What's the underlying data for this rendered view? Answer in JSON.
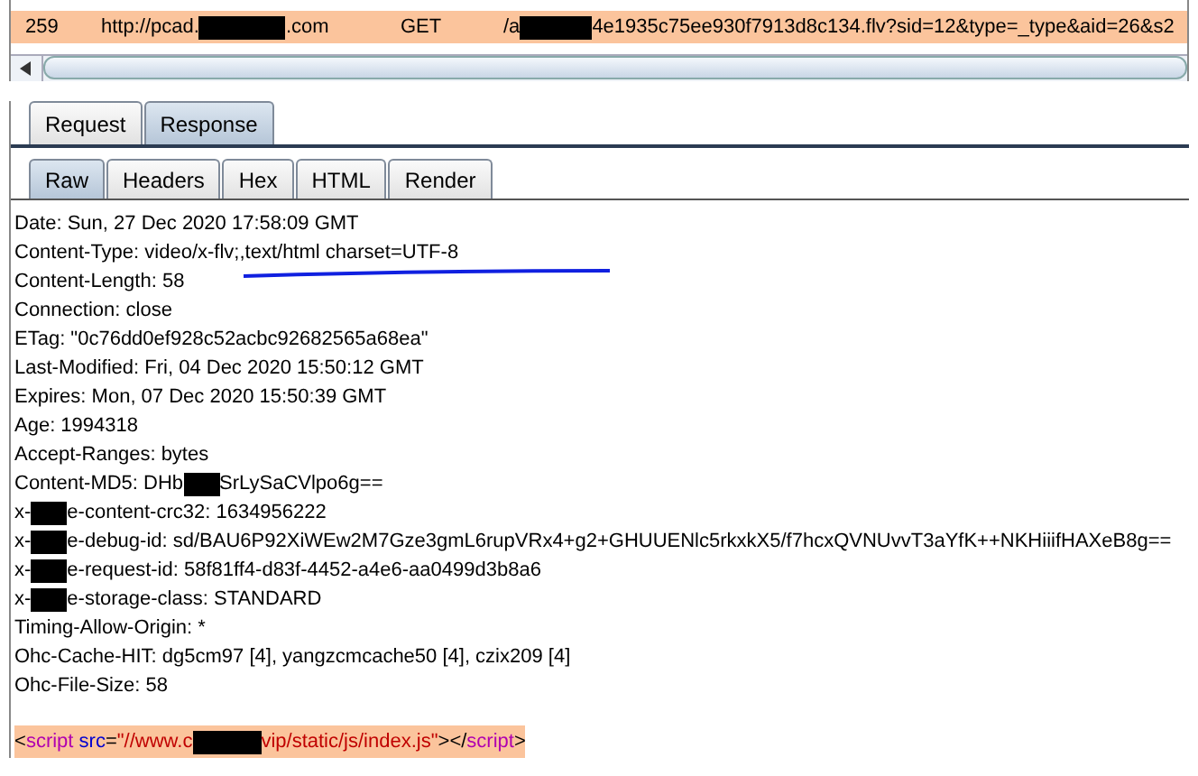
{
  "history_row": {
    "number": "259",
    "host": [
      {
        "kind": "text",
        "text": "http://pcad."
      },
      {
        "kind": "redaction"
      },
      {
        "kind": "text",
        "text": ".com"
      }
    ],
    "method": "GET",
    "url": [
      {
        "kind": "text",
        "text": "/a"
      },
      {
        "kind": "redaction"
      },
      {
        "kind": "text",
        "text": "4e1935c75ee930f7913d8c134.flv?sid=12&type=_type&aid=26&s2"
      }
    ],
    "selected": true
  },
  "tabs": [
    {
      "label": "Request",
      "selected": false
    },
    {
      "label": "Response",
      "selected": true
    }
  ],
  "subtabs": [
    {
      "label": "Raw",
      "selected": true
    },
    {
      "label": "Headers",
      "selected": false
    },
    {
      "label": "Hex",
      "selected": false
    },
    {
      "label": "HTML",
      "selected": false
    },
    {
      "label": "Render",
      "selected": false
    }
  ],
  "headers": [
    [
      {
        "kind": "text",
        "text": "Date: Sun, 27 Dec 2020 17:58:09 GMT"
      }
    ],
    [
      {
        "kind": "text",
        "text": "Content-Type: video/x-flv;,text/html charset=UTF-8"
      }
    ],
    [
      {
        "kind": "text",
        "text": "Content-Length: 58"
      }
    ],
    [
      {
        "kind": "text",
        "text": "Connection: close"
      }
    ],
    [
      {
        "kind": "text",
        "text": "ETag: \"0c76dd0ef928c52acbc92682565a68ea\""
      }
    ],
    [
      {
        "kind": "text",
        "text": "Last-Modified: Fri, 04 Dec 2020 15:50:12 GMT"
      }
    ],
    [
      {
        "kind": "text",
        "text": "Expires: Mon, 07 Dec 2020 15:50:39 GMT"
      }
    ],
    [
      {
        "kind": "text",
        "text": "Age: 1994318"
      }
    ],
    [
      {
        "kind": "text",
        "text": "Accept-Ranges: bytes"
      }
    ],
    [
      {
        "kind": "text",
        "text": "Content-MD5: DHb"
      },
      {
        "kind": "redaction"
      },
      {
        "kind": "text",
        "text": "SrLySaCVlpo6g=="
      }
    ],
    [
      {
        "kind": "text",
        "text": "x-"
      },
      {
        "kind": "redaction"
      },
      {
        "kind": "text",
        "text": "e-content-crc32: 1634956222"
      }
    ],
    [
      {
        "kind": "text",
        "text": "x-"
      },
      {
        "kind": "redaction"
      },
      {
        "kind": "text",
        "text": "e-debug-id: sd/BAU6P92XiWEw2M7Gze3gmL6rupVRx4+g2+GHUUENlc5rkxkX5/f7hcxQVNUvvT3aYfK++NKHiiifHAXeB8g=="
      }
    ],
    [
      {
        "kind": "text",
        "text": "x-"
      },
      {
        "kind": "redaction"
      },
      {
        "kind": "text",
        "text": "e-request-id: 58f81ff4-d83f-4452-a4e6-aa0499d3b8a6"
      }
    ],
    [
      {
        "kind": "text",
        "text": "x-"
      },
      {
        "kind": "redaction"
      },
      {
        "kind": "text",
        "text": "e-storage-class: STANDARD"
      }
    ],
    [
      {
        "kind": "text",
        "text": "Timing-Allow-Origin: *"
      }
    ],
    [
      {
        "kind": "text",
        "text": "Ohc-Cache-HIT: dg5cm97 [4], yangzcmcache50 [4], czix209 [4]"
      }
    ],
    [
      {
        "kind": "text",
        "text": "Ohc-File-Size: 58"
      }
    ]
  ],
  "body": [
    {
      "kind": "punct",
      "text": "<"
    },
    {
      "kind": "tag",
      "text": "script"
    },
    {
      "kind": "attr",
      "text": " src"
    },
    {
      "kind": "punct",
      "text": "="
    },
    {
      "kind": "string",
      "text": "\"//www.c"
    },
    {
      "kind": "redaction"
    },
    {
      "kind": "string",
      "text": "vip/static/js/index.js\""
    },
    {
      "kind": "punct",
      "text": "></"
    },
    {
      "kind": "tag",
      "text": "script"
    },
    {
      "kind": "punct",
      "text": ">"
    }
  ]
}
